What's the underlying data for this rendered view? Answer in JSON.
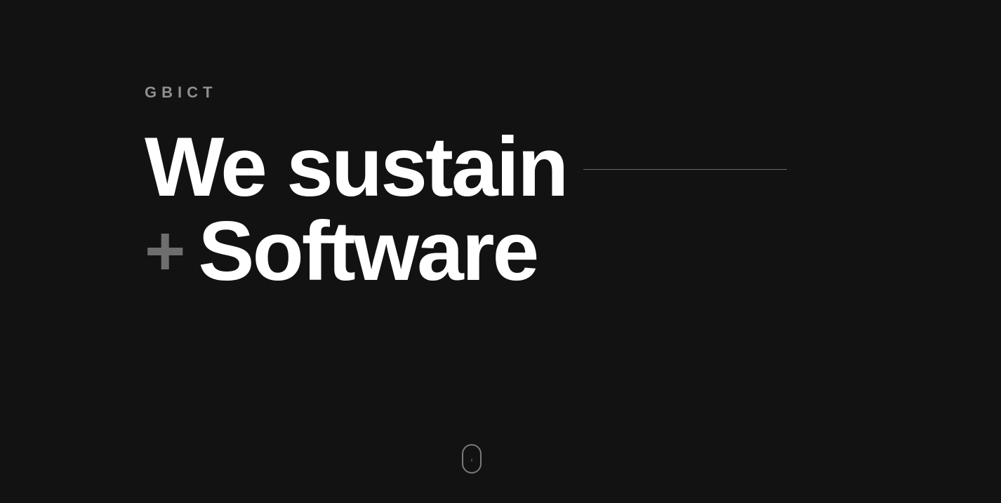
{
  "brand": {
    "name": "GBICT"
  },
  "hero": {
    "line1": "We sustain",
    "plus": "+",
    "line2": "Software"
  },
  "colors": {
    "background": "#121212",
    "headline": "#ffffff",
    "brand": "#8f8f8f",
    "accent_plus": "#6e6e6e",
    "divider": "#6b6b6b"
  },
  "icons": {
    "scroll": "mouse-scroll-icon"
  }
}
